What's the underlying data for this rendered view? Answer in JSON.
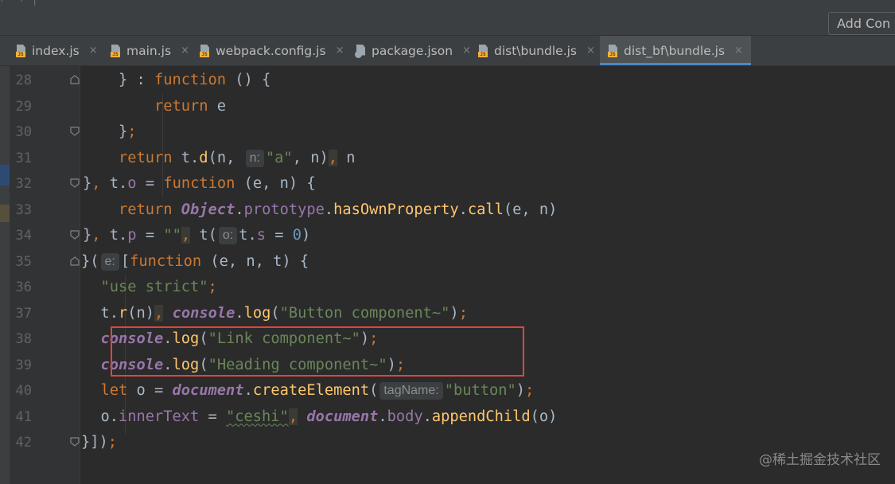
{
  "topbar": {
    "faint_text": "⌐  ·  ⌐  |",
    "add_config_label": "Add Con"
  },
  "tabs": [
    {
      "label": "index.js",
      "icon": "js-file-icon",
      "active": false
    },
    {
      "label": "main.js",
      "icon": "js-file-icon",
      "active": false
    },
    {
      "label": "webpack.config.js",
      "icon": "js-file-icon",
      "active": false
    },
    {
      "label": "package.json",
      "icon": "json-file-icon",
      "active": false
    },
    {
      "label": "dist\\bundle.js",
      "icon": "js-file-icon",
      "active": false
    },
    {
      "label": "dist_bf\\bundle.js",
      "icon": "js-file-icon",
      "active": true
    }
  ],
  "close_glyph": "×",
  "editor": {
    "line_numbers": [
      "28",
      "29",
      "30",
      "31",
      "32",
      "33",
      "34",
      "35",
      "36",
      "37",
      "38",
      "39",
      "40",
      "41",
      "42"
    ],
    "hints": {
      "n": "n:",
      "o": "o:",
      "e": "e:",
      "tagName": "tagName:"
    },
    "strings": {
      "a": "\"a\"",
      "empty": "\"\"",
      "use_strict": "\"use strict\"",
      "button_component": "\"Button component~\"",
      "link_component": "\"Link component~\"",
      "heading_component": "\"Heading component~\"",
      "button": "\"button\"",
      "ceshi": "\"ceshi\""
    }
  },
  "watermark": "@稀土掘金技术社区"
}
